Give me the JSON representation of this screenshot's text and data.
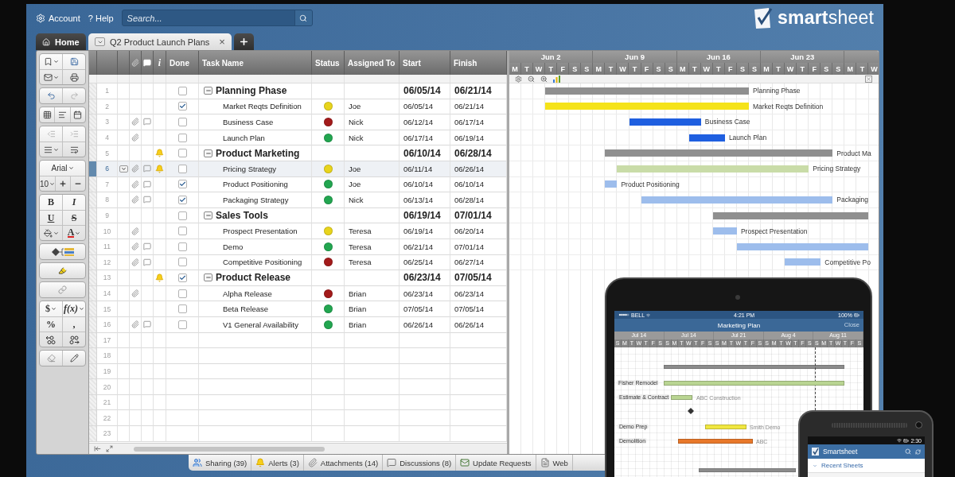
{
  "top_bar": {
    "account": "Account",
    "help_mark": "?",
    "help": "Help",
    "search": {
      "placeholder": "Search..."
    },
    "logo": "**smart**sheet"
  },
  "tabs": [
    {
      "kind": "home",
      "label": "Home",
      "selected": false
    },
    {
      "kind": "sheet",
      "label": "Q2 Product Launch Plans",
      "close": "×",
      "selected": true
    },
    {
      "kind": "add",
      "selected": false
    }
  ],
  "toolbar": {
    "font": "Arial",
    "size": "10",
    "bold": "B",
    "italic": "I",
    "underline": "U",
    "strike": "S",
    "font_color": "A",
    "currency": "$",
    "formula": "f(x)",
    "percent": "%",
    "comma": ","
  },
  "table": {
    "columns": {
      "info": "i",
      "done": "Done",
      "task": "Task Name",
      "status": "Status",
      "assigned": "Assigned To",
      "start": "Start",
      "finish": "Finish"
    },
    "rows": [
      {
        "kind": "phase",
        "num": "1",
        "name": "Planning Phase",
        "done": false,
        "alert": false,
        "expanded": true,
        "selected": false,
        "start": "06/05/14",
        "finish": "06/21/14",
        "children": [
          {
            "kind": "task",
            "num": "2",
            "name": "Market Reqts Definition",
            "done": true,
            "attachment": false,
            "comment": false,
            "alert": false,
            "selected": false,
            "color": "#e8d41c",
            "assigned": "Joe",
            "start": "06/05/14",
            "finish": "06/21/14"
          },
          {
            "kind": "task",
            "num": "3",
            "name": "Business Case",
            "done": false,
            "attachment": true,
            "comment": true,
            "alert": false,
            "selected": false,
            "color": "#a31a1a",
            "assigned": "Nick",
            "start": "06/12/14",
            "finish": "06/17/14"
          },
          {
            "kind": "task",
            "num": "4",
            "name": "Launch Plan",
            "done": false,
            "attachment": true,
            "comment": false,
            "alert": false,
            "selected": false,
            "color": "#22a650",
            "assigned": "Nick",
            "start": "06/17/14",
            "finish": "06/19/14"
          }
        ]
      },
      {
        "kind": "phase",
        "num": "5",
        "name": "Product Marketing",
        "done": false,
        "alert": true,
        "expanded": true,
        "selected": false,
        "start": "06/10/14",
        "finish": "06/28/14",
        "children": [
          {
            "kind": "task",
            "num": "6",
            "name": "Pricing Strategy",
            "done": false,
            "attachment": true,
            "comment": true,
            "alert": true,
            "selected": true,
            "color": "#e8d41c",
            "assigned": "Joe",
            "start": "06/11/14",
            "finish": "06/26/14"
          },
          {
            "kind": "task",
            "num": "7",
            "name": "Product Positioning",
            "done": true,
            "attachment": true,
            "comment": true,
            "alert": false,
            "selected": false,
            "color": "#22a650",
            "assigned": "Joe",
            "start": "06/10/14",
            "finish": "06/10/14"
          },
          {
            "kind": "task",
            "num": "8",
            "name": "Packaging Strategy",
            "done": true,
            "attachment": true,
            "comment": true,
            "alert": false,
            "selected": false,
            "color": "#22a650",
            "assigned": "Nick",
            "start": "06/13/14",
            "finish": "06/28/14"
          }
        ]
      },
      {
        "kind": "phase",
        "num": "9",
        "name": "Sales Tools",
        "done": false,
        "alert": false,
        "expanded": true,
        "selected": false,
        "start": "06/19/14",
        "finish": "07/01/14",
        "children": [
          {
            "kind": "task",
            "num": "10",
            "name": "Prospect Presentation",
            "done": false,
            "attachment": true,
            "comment": false,
            "alert": false,
            "selected": false,
            "color": "#e8d41c",
            "assigned": "Teresa",
            "start": "06/19/14",
            "finish": "06/20/14"
          },
          {
            "kind": "task",
            "num": "11",
            "name": "Demo",
            "done": false,
            "attachment": true,
            "comment": true,
            "alert": false,
            "selected": false,
            "color": "#22a650",
            "assigned": "Teresa",
            "start": "06/21/14",
            "finish": "07/01/14"
          },
          {
            "kind": "task",
            "num": "12",
            "name": "Competitive Positioning",
            "done": false,
            "attachment": true,
            "comment": true,
            "alert": false,
            "selected": false,
            "color": "#a31a1a",
            "assigned": "Teresa",
            "start": "06/25/14",
            "finish": "06/27/14"
          }
        ]
      },
      {
        "kind": "phase",
        "num": "13",
        "name": "Product Release",
        "done": true,
        "alert": true,
        "expanded": true,
        "selected": false,
        "start": "06/23/14",
        "finish": "07/05/14",
        "children": [
          {
            "kind": "task",
            "num": "14",
            "name": "Alpha Release",
            "done": false,
            "attachment": true,
            "comment": false,
            "alert": false,
            "selected": false,
            "color": "#a31a1a",
            "assigned": "Brian",
            "start": "06/23/14",
            "finish": "06/23/14"
          },
          {
            "kind": "task",
            "num": "15",
            "name": "Beta Release",
            "done": false,
            "attachment": false,
            "comment": false,
            "alert": false,
            "selected": false,
            "color": "#22a650",
            "assigned": "Brian",
            "start": "07/05/14",
            "finish": "07/05/14"
          },
          {
            "kind": "task",
            "num": "16",
            "name": "V1 General Availability",
            "done": false,
            "attachment": true,
            "comment": true,
            "alert": false,
            "selected": false,
            "color": "#22a650",
            "assigned": "Brian",
            "start": "06/26/14",
            "finish": "06/26/14"
          }
        ]
      }
    ],
    "empty_rows": [
      "17",
      "18",
      "19",
      "20",
      "21",
      "22",
      "23"
    ]
  },
  "gantt": {
    "weeks": [
      "Jun 2",
      "Jun 9",
      "Jun 16",
      "Jun 23"
    ],
    "days": [
      "M",
      "T",
      "W",
      "T",
      "F",
      "S",
      "S",
      "M",
      "T",
      "W",
      "T",
      "F",
      "S",
      "S",
      "M",
      "T",
      "W",
      "T",
      "F",
      "S",
      "S",
      "M",
      "T",
      "W",
      "T",
      "F",
      "S",
      "S",
      "M",
      "T",
      "W"
    ],
    "bars": [
      {
        "label": "Planning Phase",
        "color": "#8f8f8f"
      },
      {
        "label": "Market Reqts Definition",
        "color": "#f5e31a"
      },
      {
        "label": "Business Case",
        "color": "#1f5fe0"
      },
      {
        "label": "Launch Plan",
        "color": "#1f5fe0"
      },
      {
        "label": "Product Ma",
        "color": "#8f8f8f"
      },
      {
        "label": "Pricing Strategy",
        "color": "#c9dca8"
      },
      {
        "label": "Product Positioning",
        "color": "#9dbdec"
      },
      {
        "label": "Packaging",
        "color": "#9dbdec"
      },
      {
        "color": "#8f8f8f"
      },
      {
        "label": "Prospect Presentation",
        "color": "#9dbdec"
      },
      {
        "color": "#9dbdec"
      },
      {
        "label": "Competitive Po",
        "color": "#9dbdec"
      }
    ]
  },
  "bottom_tabs": [
    {
      "label": "Sharing (39)"
    },
    {
      "label": "Alerts (3)"
    },
    {
      "label": "Attachments (14)"
    },
    {
      "label": "Discussions (8)"
    },
    {
      "label": "Update Requests"
    },
    {
      "label": "Web"
    }
  ],
  "tablet": {
    "carrier": "BELL",
    "time": "4:21 PM",
    "battery": "100%",
    "title": "Marketing Plan",
    "close": "Close",
    "weeks": [
      "Jul 14",
      "Jul 14",
      "Jul 21",
      "Aug 4",
      "Aug 11"
    ],
    "days": [
      "S",
      "M",
      "T",
      "W",
      "T",
      "F",
      "S",
      "S",
      "M",
      "T",
      "W",
      "T",
      "F",
      "S",
      "S",
      "M",
      "T",
      "W",
      "T",
      "F",
      "S",
      "S",
      "M",
      "T",
      "W",
      "T",
      "F",
      "S",
      "S",
      "M",
      "T",
      "W",
      "T",
      "F",
      "S"
    ],
    "tasks": [
      {
        "label": "Fisher Remodel",
        "color": "#b9d592"
      },
      {
        "label": "Estimate & Contract",
        "color": "#b9d592",
        "assignee": "ABC Construction"
      },
      {
        "label": "Demo Prep",
        "color": "#f0e640",
        "assignee": "Smith Demo"
      },
      {
        "label": "Demolition",
        "color": "#e8782a",
        "assignee": "ABC"
      }
    ]
  },
  "phone": {
    "time": "2:30",
    "title": "Smartsheet",
    "section": "Recent Sheets"
  }
}
